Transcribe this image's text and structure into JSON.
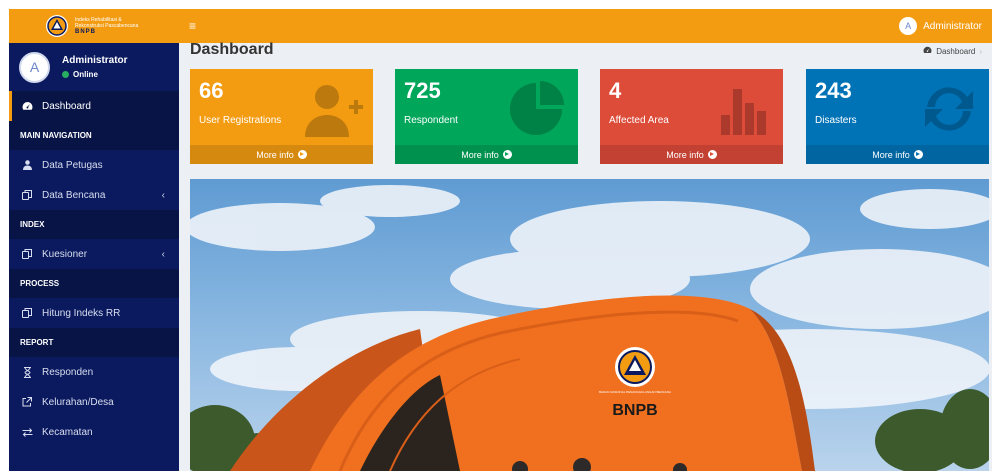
{
  "logo": {
    "line1": "Indeks Rehabilitasi &",
    "line2": "Rekonstruksi Pascabencana",
    "org": "BNPB"
  },
  "sidebar": {
    "user": {
      "initial": "A",
      "name": "Administrator",
      "status": "Online"
    },
    "dashboard_label": "Dashboard",
    "headers": {
      "main": "MAIN NAVIGATION",
      "index": "INDEX",
      "process": "PROCESS",
      "report": "REPORT"
    },
    "items": {
      "data_petugas": "Data Petugas",
      "data_bencana": "Data Bencana",
      "kuesioner": "Kuesioner",
      "hitung": "Hitung Indeks RR",
      "responden": "Responden",
      "kelurahan": "Kelurahan/Desa",
      "kecamatan": "Kecamatan"
    }
  },
  "topbar": {
    "menu_icon": "hamburger-icon",
    "user_initial": "A",
    "user_name": "Administrator"
  },
  "page": {
    "title": "Dashboard",
    "breadcrumb": "Dashboard"
  },
  "boxes": [
    {
      "value": "66",
      "label": "User Registrations",
      "footer": "More info",
      "color": "#f39c12",
      "icon": "user-plus-icon"
    },
    {
      "value": "725",
      "label": "Respondent",
      "footer": "More info",
      "color": "#00a65a",
      "icon": "pie-chart-icon"
    },
    {
      "value": "4",
      "label": "Affected Area",
      "footer": "More info",
      "color": "#dd4b39",
      "icon": "bar-chart-icon"
    },
    {
      "value": "243",
      "label": "Disasters",
      "footer": "More info",
      "color": "#0073b7",
      "icon": "refresh-icon"
    }
  ],
  "photo": {
    "tent_label": "BNPB",
    "emblem_text": "BADAN NASIONAL PENANGGULANGAN BENCANA"
  },
  "colors": {
    "accent": "#f39c12",
    "sidebar": "#0b1a5e",
    "sidebar_dark": "#081446"
  }
}
